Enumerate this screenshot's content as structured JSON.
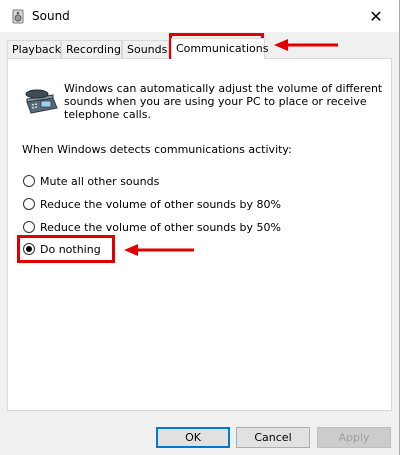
{
  "window": {
    "title": "Sound",
    "close_glyph": "✕",
    "title_icon": "speaker-icon"
  },
  "tabs": [
    {
      "label": "Playback",
      "active": false
    },
    {
      "label": "Recording",
      "active": false
    },
    {
      "label": "Sounds",
      "active": false
    },
    {
      "label": "Communications",
      "active": true
    }
  ],
  "communications": {
    "description": "Windows can automatically adjust the volume of different sounds when you are using your PC to place or receive telephone calls.",
    "prompt": "When Windows detects communications activity:",
    "options": [
      {
        "label": "Mute all other sounds",
        "checked": false
      },
      {
        "label": "Reduce the volume of other sounds by 80%",
        "checked": false
      },
      {
        "label": "Reduce the volume of other sounds by 50%",
        "checked": false
      },
      {
        "label": "Do nothing",
        "checked": true
      }
    ],
    "icon": "telephone-icon"
  },
  "buttons": {
    "ok": "OK",
    "cancel": "Cancel",
    "apply": "Apply"
  },
  "annotations": {
    "highlight_color": "#e00000"
  }
}
